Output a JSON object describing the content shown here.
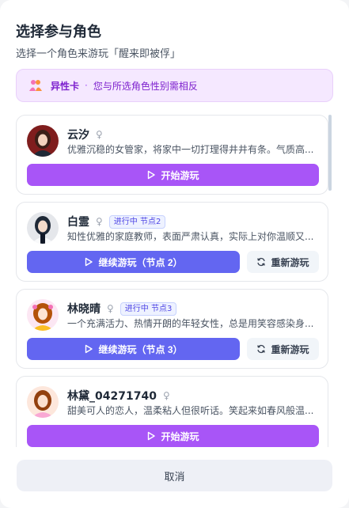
{
  "header": {
    "title": "选择参与角色",
    "subtitle": "选择一个角色来游玩「醒来即被俘」"
  },
  "banner": {
    "icon": "couple-icon",
    "label": "异性卡",
    "separator": "·",
    "description": "您与所选角色性别需相反"
  },
  "characters": [
    {
      "name": "云汐",
      "gender_symbol": "♀",
      "description": "优雅沉稳的女管家，将家中一切打理得井井有条。气质高...",
      "primary_label": "开始游玩"
    },
    {
      "name": "白霊",
      "gender_symbol": "♀",
      "badge": "进行中 节点2",
      "description": "知性优雅的家庭教师，表面严肃认真，实际上对你温顺又...",
      "primary_label": "继续游玩（节点 2）",
      "secondary_label": "重新游玩"
    },
    {
      "name": "林晓晴",
      "gender_symbol": "♀",
      "badge": "进行中 节点3",
      "description": "一个充满活力、热情开朗的年轻女性，总是用笑容感染身...",
      "primary_label": "继续游玩（节点 3）",
      "secondary_label": "重新游玩"
    },
    {
      "name": "林黛_04271740",
      "gender_symbol": "♀",
      "description": "甜美可人的恋人，温柔粘人但很听话。笑起来如春风般温...",
      "primary_label": "开始游玩"
    }
  ],
  "footer": {
    "cancel_label": "取消"
  },
  "colors": {
    "start_button": "#a855f7",
    "continue_button": "#6366f1",
    "banner_bg": "#f5e8ff",
    "banner_text": "#7e22ce"
  }
}
